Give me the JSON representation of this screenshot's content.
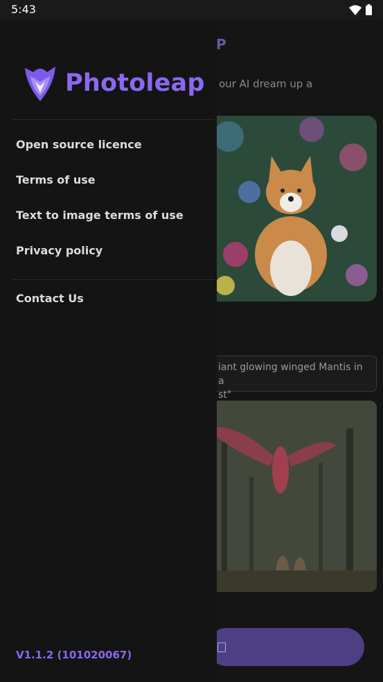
{
  "status_bar": {
    "time": "5:43"
  },
  "background": {
    "title_partial": "P",
    "subtitle_partial": "our AI dream up a",
    "prompt_partial_line1": "iant glowing winged Mantis in a",
    "prompt_partial_line2": "st\""
  },
  "drawer": {
    "brand_name": "Photoleap",
    "menu": [
      {
        "label": "Open source licence"
      },
      {
        "label": "Terms of use"
      },
      {
        "label": "Text to image terms of use"
      },
      {
        "label": "Privacy policy"
      }
    ],
    "contact_label": "Contact Us",
    "version": "V1.1.2 (101020067)"
  },
  "colors": {
    "accent": "#8b68f0",
    "background": "#141414",
    "menu_text": "#dcdcdc"
  }
}
